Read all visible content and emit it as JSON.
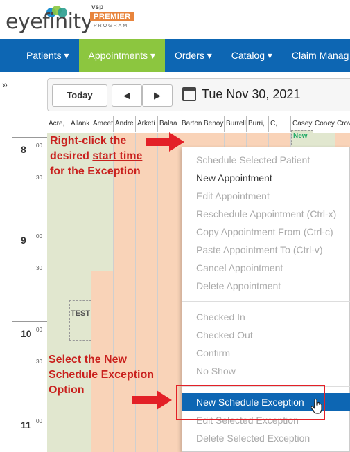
{
  "brand": {
    "logo_text": "eyefinity",
    "vsp": "vsp",
    "premier": "PREMIER",
    "program": "PROGRAM"
  },
  "nav": {
    "items": [
      {
        "label": "Patients ▾"
      },
      {
        "label": "Appointments ▾"
      },
      {
        "label": "Orders ▾"
      },
      {
        "label": "Catalog ▾"
      },
      {
        "label": "Claim Manag"
      }
    ]
  },
  "sidebar_toggle": "»",
  "toolbar": {
    "today_label": "Today",
    "prev_label": "◀",
    "next_label": "▶",
    "date": "Tue Nov 30, 2021"
  },
  "columns": [
    "Acre,",
    "Allank",
    "Ameet",
    "Andre",
    "Arketi",
    "Balaa",
    "Barton",
    "Benoy",
    "Burrell",
    "Burri,",
    "C,",
    "Casey",
    "Coney",
    "Crow"
  ],
  "times": {
    "hours": [
      "8",
      "9",
      "10",
      "11"
    ],
    "minutes": [
      "00",
      "30"
    ]
  },
  "appointments": {
    "test_label": "TEST",
    "new_label": "New"
  },
  "annotations": {
    "right_click_1": "Right-click the",
    "right_click_2a": "desired ",
    "right_click_2b": "start time",
    "right_click_3": "for the Exception",
    "select_1": "Select the New",
    "select_2": "Schedule Exception",
    "select_3": "Option"
  },
  "context_menu": {
    "items": [
      {
        "label": "Schedule Selected Patient"
      },
      {
        "label": "New Appointment"
      },
      {
        "label": "Edit Appointment"
      },
      {
        "label": "Reschedule Appointment (Ctrl-x)"
      },
      {
        "label": "Copy Appointment From (Ctrl-c)"
      },
      {
        "label": "Paste Appointment To (Ctrl-v)"
      },
      {
        "label": "Cancel Appointment"
      },
      {
        "label": "Delete Appointment"
      },
      {
        "label": "Checked In"
      },
      {
        "label": "Checked Out"
      },
      {
        "label": "Confirm"
      },
      {
        "label": "No Show"
      },
      {
        "label": "New Schedule Exception"
      },
      {
        "label": "Edit Selected Exception"
      },
      {
        "label": "Delete Selected Exception"
      }
    ]
  },
  "colors": {
    "nav_bg": "#0d66b3",
    "nav_active": "#8cc63f",
    "cell_green": "#e1e7cf",
    "cell_peach": "#f9d3b8",
    "annotation_red": "#c9211e",
    "highlight_blue": "#0d66b3"
  }
}
